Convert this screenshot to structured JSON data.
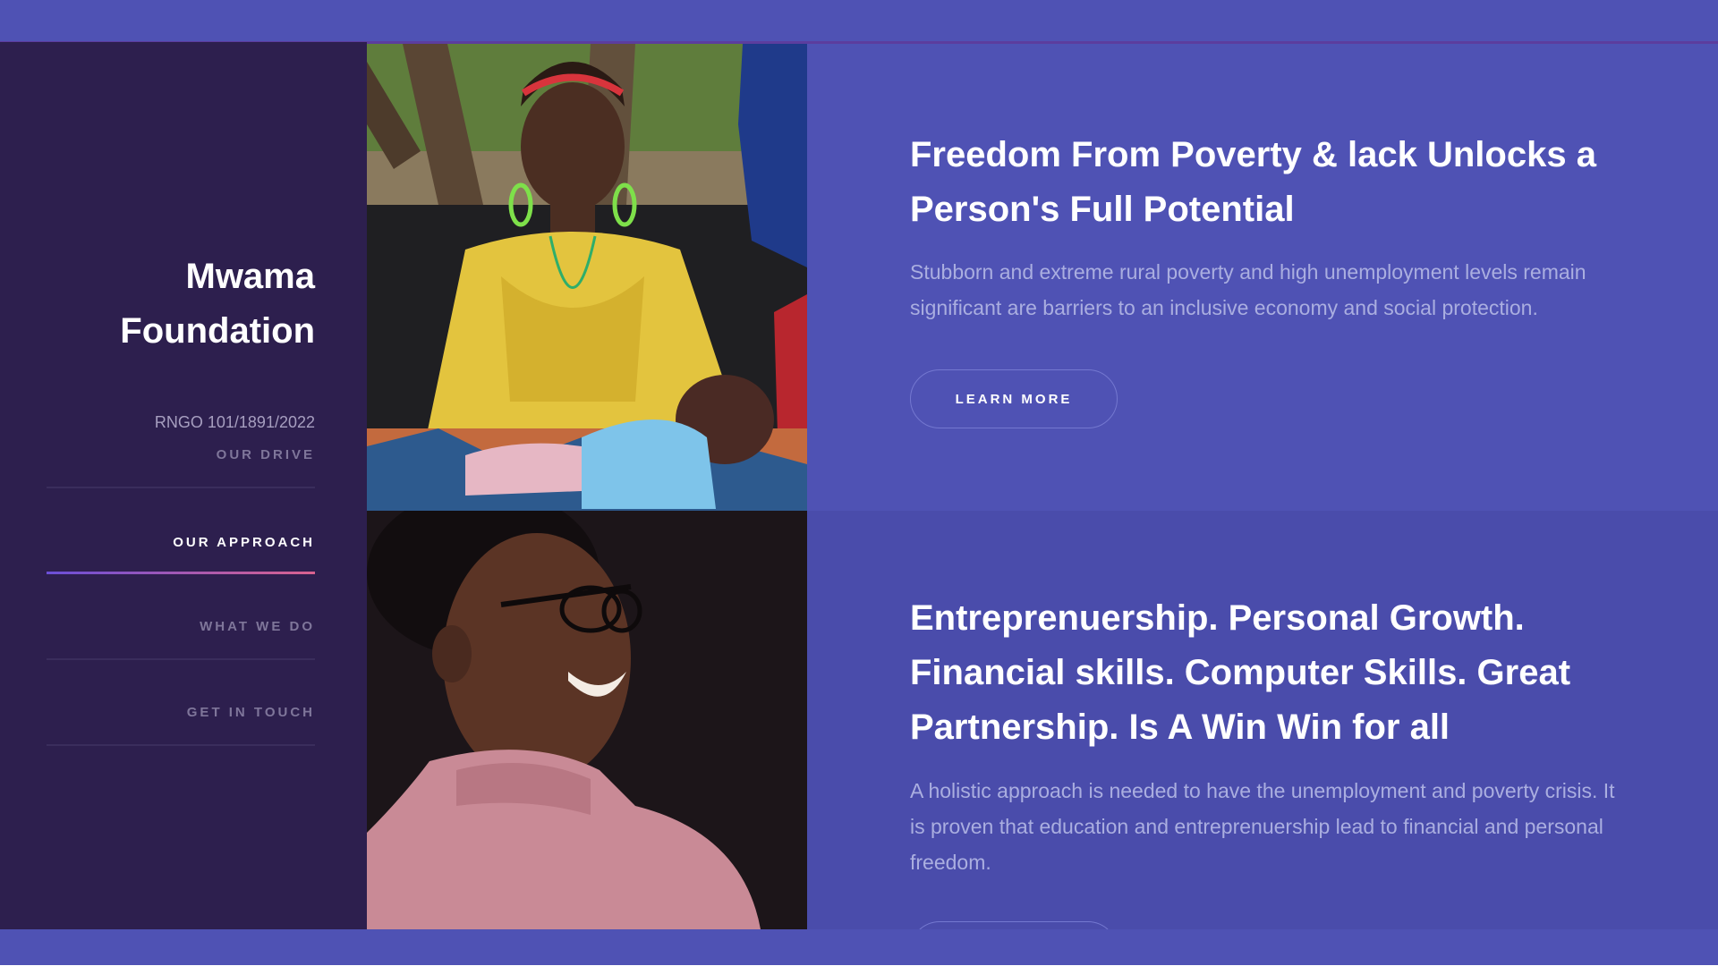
{
  "sidebar": {
    "brand_title": "Mwama Foundation",
    "registration": "RNGO 101/1891/2022",
    "nav": [
      {
        "label": "OUR DRIVE",
        "active": false
      },
      {
        "label": "OUR APPROACH",
        "active": true
      },
      {
        "label": "WHAT WE DO",
        "active": false
      },
      {
        "label": "GET IN TOUCH",
        "active": false
      }
    ]
  },
  "sections": [
    {
      "heading": "Freedom From Poverty & lack Unlocks a Person's Full Potential",
      "body": "Stubborn and extreme rural poverty and high unemployment levels remain significant are barriers to an inclusive economy and social protection.",
      "button_label": "LEARN MORE"
    },
    {
      "heading": "Entreprenuership. Personal Growth. Financial skills. Computer Skills. Great Partnership. Is A Win Win for all",
      "body": "A holistic approach is needed to have the unemployment and poverty crisis. It is proven that education and entreprenuership lead to financial and personal freedom."
    }
  ],
  "colors": {
    "sidebar_bg": "#2d1f4e",
    "content_bg": "#4f52b4",
    "accent_gradient_start": "#6b4fd8",
    "accent_gradient_end": "#d9628f"
  },
  "images": [
    {
      "icon": "photo-woman-with-baby-icon"
    },
    {
      "icon": "photo-smiling-woman-icon"
    }
  ]
}
